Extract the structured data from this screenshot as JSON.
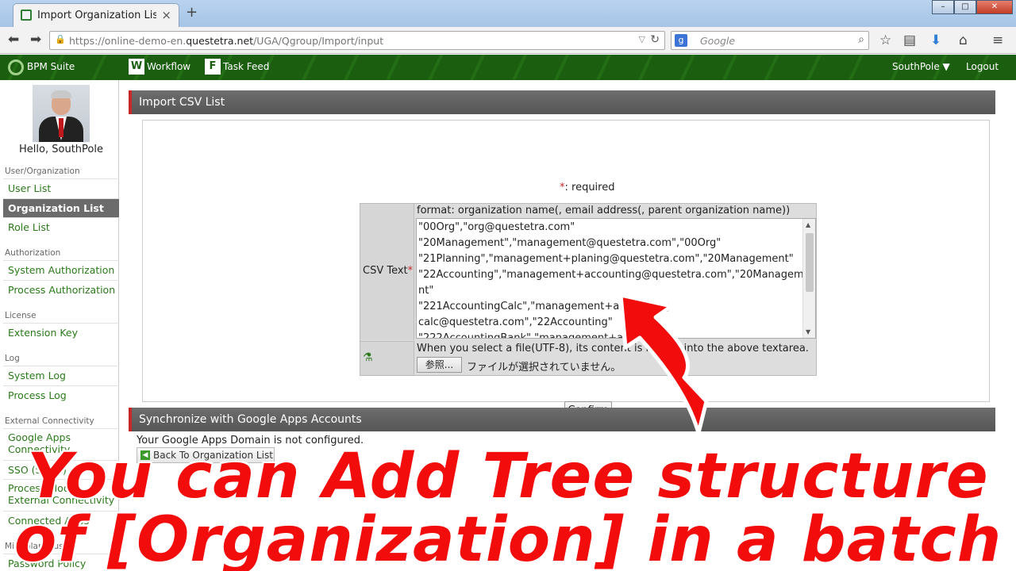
{
  "browser": {
    "tab_title": "Import Organization Lis...",
    "url_prefix": "https://online-demo-en.",
    "url_domain": "questetra.net",
    "url_path": "/UGA/Qgroup/Import/input",
    "search_placeholder": "Google",
    "search_engine_glyph": "g"
  },
  "appheader": {
    "brand": "BPM Suite",
    "workflow": "Workflow",
    "workflow_glyph": "W",
    "taskfeed": "Task Feed",
    "taskfeed_glyph": "F",
    "user_menu": "SouthPole ▼",
    "logout": "Logout"
  },
  "sidebar": {
    "hello": "Hello, SouthPole",
    "sections": {
      "user_org": "User/Organization",
      "authorization": "Authorization",
      "license": "License",
      "log": "Log",
      "external": "External Connectivity",
      "misc": "Miscellaneous"
    },
    "items": {
      "user_list": "User List",
      "org_list": "Organization List",
      "role_list": "Role List",
      "system_auth": "System Authorization",
      "process_auth": "Process Authorization",
      "extension_key": "Extension Key",
      "system_log": "System Log",
      "process_log": "Process Log",
      "google_apps": "Google Apps Connectivity",
      "sso": "SSO (SAML)",
      "pm_external": "Process Model External Connectivity",
      "connected_apps": "Connected Apps",
      "password_policy": "Password Policy"
    }
  },
  "main": {
    "import_title": "Import CSV List",
    "required_star": "*",
    "required_text": ": required",
    "csv_label": "CSV Text",
    "csv_star": "*",
    "format": "format: organization name(, email address(, parent organization name))",
    "csv_lines": [
      "\"00Org\",\"org@questetra.com\"",
      "\"20Management\",\"management@questetra.com\",\"00Org\"",
      "\"21Planning\",\"management+planing@questetra.com\",\"20Management\"",
      "\"22Accounting\",\"management+accounting@questetra.com\",\"20Manageme",
      "nt\"",
      "\"221AccountingCalc\",\"management+accounting-",
      "calc@questetra.com\",\"22Accounting\"",
      "\"222AccountingBank\",\"management+accounting-"
    ],
    "file_note": "When you select a file(UTF-8), its content is loaded into the above textarea.",
    "browse_button": "参照...",
    "no_file": "ファイルが選択されていません。",
    "confirm": "Confirm",
    "sync_title": "Synchronize with Google Apps Accounts",
    "sync_note": "Your Google Apps Domain is not configured.",
    "back_button": "Back To Organization List"
  },
  "overlay": {
    "line1": "You can Add Tree structure",
    "line2": "of [Organization] in a batch",
    "color": "#f20c0c"
  }
}
